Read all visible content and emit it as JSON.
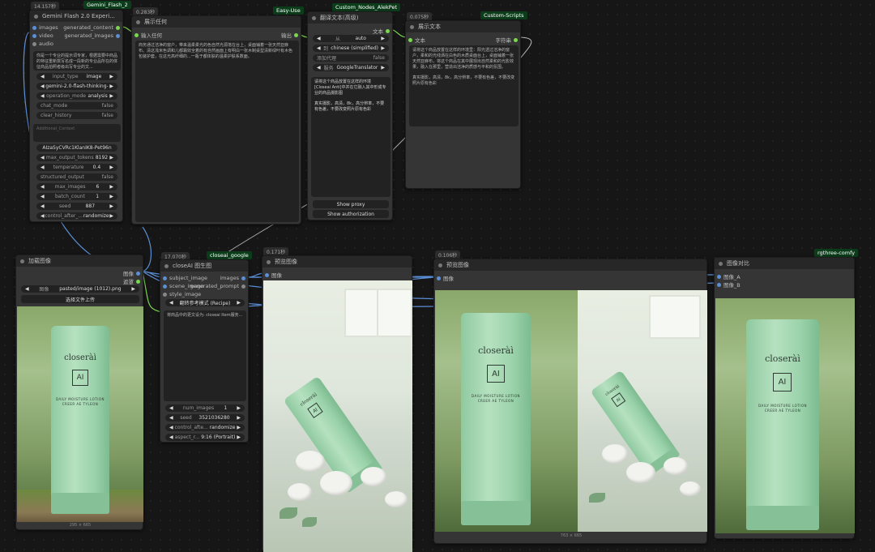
{
  "colors": {
    "canvas": "#161616",
    "node": "#353535",
    "header": "#272727",
    "badge": "#0c3d1a",
    "pin_blue": "#5b8fd6",
    "pin_green": "#7bd650"
  },
  "gemini": {
    "timer": "14.157秒",
    "badge": "Gemini_Flash_2",
    "title": "Gemini Flash 2.0 Experi...",
    "inputs": [
      "images",
      "video",
      "audio"
    ],
    "outputs": [
      "generated_content",
      "generated_images"
    ],
    "prompt_text": "你是一个专业的提示词专家，根据需要中商品的特征重新撰写名成一段新的专业品所在的体征商品拍照者级出写专业的文...",
    "widgets": [
      {
        "label": "input_type",
        "value": "image"
      },
      {
        "label": "",
        "value": "gemini-2.0-flash-thinking-"
      },
      {
        "label": "operation_mode",
        "value": "analysis"
      },
      {
        "label": "chat_mode",
        "value": "false"
      },
      {
        "label": "clear_history",
        "value": "false"
      }
    ],
    "additional_placeholder": "Additional_Context",
    "api_key": "AIzaSyCVRc1KlanIK8-Pet96n",
    "widgets2": [
      {
        "label": "max_output_tokens",
        "value": "8192"
      },
      {
        "label": "temperature",
        "value": "0.4"
      },
      {
        "label": "structured_output",
        "value": "false"
      },
      {
        "label": "max_images",
        "value": "6"
      },
      {
        "label": "batch_count",
        "value": "1"
      },
      {
        "label": "seed",
        "value": "887"
      },
      {
        "label": "control_after_...",
        "value": "randomize"
      }
    ]
  },
  "show_any": {
    "timer": "0.283秒",
    "badge": "Easy-Use",
    "title": "展示任何",
    "input": "输入任何",
    "output": "输出",
    "text": "商务通过洁净的窗户，带来温柔柔光的色自然光源落在台上，桌面铺着一张天然亚麻布。清这浅米色调和儿都霜效全着的有自然画面上有明白一张木制桌型清新绿叶有木色包装护套，在这光高纤细的...一瓶于都体肤的温柔护肤系数面。"
  },
  "translate": {
    "badge": "Custom_Nodes_AlekPet",
    "title": "翻译文本(高级)",
    "output": "文本",
    "widgets": [
      {
        "label": "从",
        "value": "auto"
      },
      {
        "label": "到",
        "value": "chinese (simplified)"
      },
      {
        "label": "添加代理",
        "value": "false"
      },
      {
        "label": "服务",
        "value": "GoogleTranslator"
      }
    ],
    "text1": "请将这个商品放置在这样的环境[Closeai Anti]中并在它融入其中形成专业的商品摄影图",
    "text2": "真实摄影，高清，8k，高分辨率，不要有色差，不要改变照片原有色彩",
    "button1": "Show proxy",
    "button2": "Show authorization"
  },
  "show_text": {
    "timer": "0.075秒",
    "badge": "Custom-Scripts",
    "title": "展示文本",
    "input": "文本",
    "output": "字符串",
    "text1": "请将这个商品放置在这样的环境里：阳光透过洁净的窗户，柔和的光线洒在白色的木质桌面台上，桌面铺着一张天然亚麻布，将这个商品在其中展现出自然柔和的光影效果，融入在那里，营造出洁净的质感与平和的氛围。",
    "text2": "真实摄影，高清，8k，高分辨率，不要有色差，不要改变照片原有色彩"
  },
  "load_image": {
    "title": "加载图像",
    "outputs": [
      "图像",
      "遮罩"
    ],
    "file_label": "图像",
    "file_value": "pasted/image (1012).png",
    "upload": "选择文件上传",
    "dims": "295 × 665"
  },
  "closeai": {
    "timer": "17.070秒",
    "badge": "closeai_google",
    "title": "closeAI 图生图",
    "inputs": [
      "subject_image",
      "scene_image",
      "style_image"
    ],
    "outputs": [
      "images",
      "generated_prompt"
    ],
    "mode": "翻转参考模式 (Recipe)",
    "prompt": "将商品中的更文设为: closeai Item服务...",
    "widgets": [
      {
        "label": "num_images",
        "value": "1"
      },
      {
        "label": "seed",
        "value": "3521036280"
      },
      {
        "label": "control_afte...",
        "value": "randomize"
      },
      {
        "label": "aspect_r...",
        "value": "9:16 (Portrait)"
      }
    ]
  },
  "preview1": {
    "timer": "0.171秒",
    "title": "预览图像",
    "input": "图像"
  },
  "preview2": {
    "timer": "0.106秒",
    "title": "预览图像",
    "input": "图像",
    "dims": "763 × 665"
  },
  "compare": {
    "badge": "rgthree-comfy",
    "title": "图像对比",
    "inputs": [
      "图像_A",
      "图像_B"
    ]
  },
  "product": {
    "brand": "closeràì",
    "mark": "AI",
    "line1": "DAILY MOISTURE LOTION",
    "line2": "CREER AE TYLEON"
  }
}
